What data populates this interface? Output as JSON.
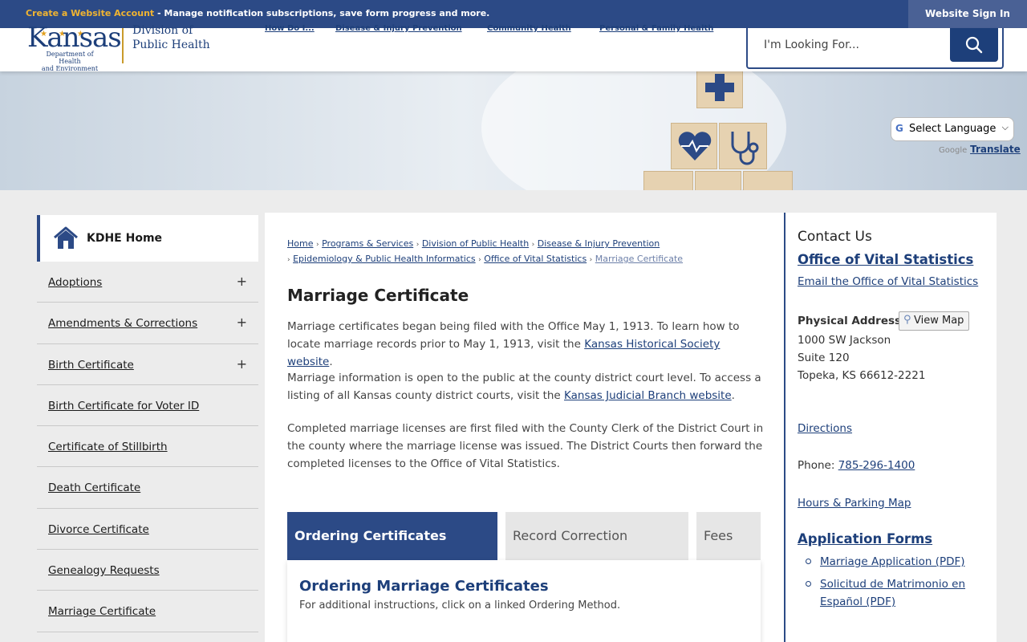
{
  "topbar": {
    "create_link": "Create a Website Account",
    "message": " - Manage notification subscriptions, save form progress and more.",
    "signin": "Website Sign In"
  },
  "logo": {
    "kansas": "Kansas",
    "dept_line1": "Department of Health",
    "dept_line2": "and Environment",
    "division_line1": "Division of",
    "division_line2": "Public Health"
  },
  "nav": [
    "How Do I...",
    "Disease & Injury Prevention",
    "Community Health",
    "Personal & Family Health"
  ],
  "search": {
    "placeholder": "I'm Looking For..."
  },
  "translate": {
    "select_label": "Select Language",
    "powered": "Google",
    "link": "Translate"
  },
  "sidebar": {
    "home": "KDHE Home",
    "items": [
      {
        "label": "Adoptions",
        "expand": "+"
      },
      {
        "label": "Amendments & Corrections",
        "expand": "+"
      },
      {
        "label": "Birth Certificate",
        "expand": "+"
      },
      {
        "label": "Birth Certificate for Voter ID",
        "expand": ""
      },
      {
        "label": "Certificate of Stillbirth",
        "expand": ""
      },
      {
        "label": "Death Certificate",
        "expand": ""
      },
      {
        "label": "Divorce Certificate",
        "expand": ""
      },
      {
        "label": "Genealogy Requests",
        "expand": ""
      },
      {
        "label": "Marriage Certificate",
        "expand": ""
      }
    ]
  },
  "breadcrumb": {
    "items": [
      "Home",
      "Programs & Services",
      "Division of Public Health",
      "Disease & Injury Prevention",
      "Epidemiology & Public Health Informatics",
      "Office of Vital Statistics"
    ],
    "current": "Marriage Certificate"
  },
  "main": {
    "title": "Marriage Certificate",
    "p1_a": "Marriage certificates began being filed with the Office May 1, 1913. To learn how to locate marriage records prior to May 1, 1913, visit the ",
    "p1_link": "Kansas Historical Society website",
    "p1_b": ".",
    "p2_a": "Marriage information is open to the public at the county district court level. To access a listing of all Kansas county district courts, visit the ",
    "p2_link": "Kansas Judicial Branch website",
    "p2_b": ".",
    "p3": "Completed marriage licenses are first filed with the County Clerk of the District Court in the county where the marriage license was issued. The District Courts then forward the completed licenses to the Office of Vital Statistics.",
    "tabs": [
      "Ordering Certificates",
      "Record Correction",
      "Fees"
    ],
    "panel_title": "Ordering Marriage Certificates",
    "panel_sub": "For additional instructions, click on a linked Ordering Method."
  },
  "contact": {
    "title": "Contact Us",
    "office": "Office of Vital Statistics",
    "email": "Email the Office of Vital Statistics",
    "physical_label": "Physical Address",
    "view_map": "View Map",
    "address": [
      "1000 SW Jackson",
      "Suite 120",
      "Topeka, KS 66612-2221"
    ],
    "directions": "Directions",
    "phone_label": "Phone: ",
    "phone": "785-296-1400",
    "hours": "Hours & Parking Map",
    "forms_title": "Application Forms",
    "forms": [
      "Marriage Application (PDF)",
      "Solicitud de Matrimonio en Español (PDF)"
    ]
  },
  "colors": {
    "brand": "#2c4a86",
    "accent": "#f0b431",
    "link": "#1d3f7a"
  }
}
